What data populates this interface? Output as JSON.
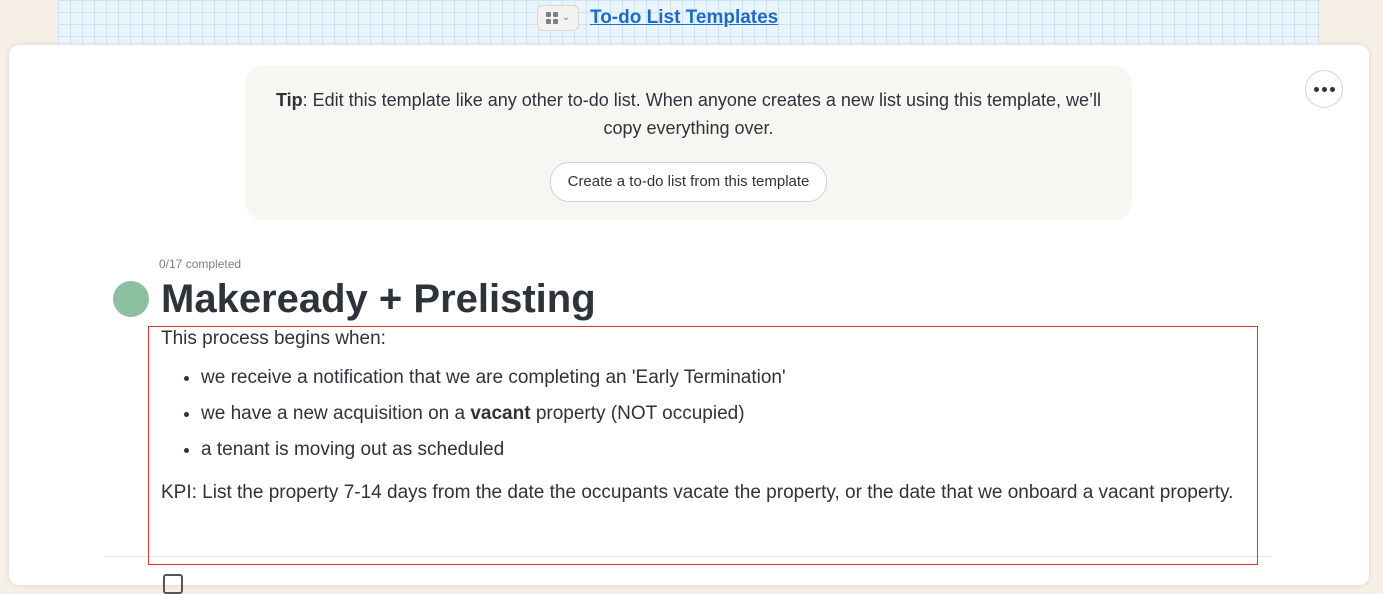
{
  "header": {
    "breadcrumb_link": "To-do List Templates",
    "switcher_icon": "grid-icon"
  },
  "tip": {
    "label": "Tip",
    "text": ": Edit this template like any other to-do list. When anyone creates a new list using this template, we’ll copy everything over.",
    "button_label": "Create a to-do list from this template"
  },
  "list": {
    "progress": "0/17 completed",
    "title": "Makeready + Prelisting",
    "dot_color": "#8cc0a0",
    "intro": "This process begins when:",
    "bullets": {
      "b1": "we receive a notification that we are completing an 'Early Termination'",
      "b2_before": "we have a new acquisition on a ",
      "b2_bold": "vacant",
      "b2_after": " property (NOT occupied)",
      "b3": "a tenant is moving out as scheduled"
    },
    "kpi": "KPI: List the property 7-14 days from the date the occupants vacate the property, or the date that we onboard a vacant property."
  },
  "colors": {
    "link": "#1d6bc9",
    "highlight_border": "#e03030",
    "text": "#2d3339"
  }
}
